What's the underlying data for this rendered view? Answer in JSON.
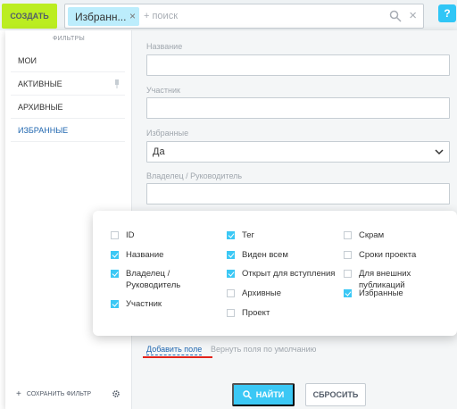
{
  "toolbar": {
    "create_label": "СОЗДАТЬ",
    "search": {
      "chip_label": "Избранн...",
      "placeholder": "+ поиск"
    },
    "help_label": "?"
  },
  "filter_panel": {
    "presets_title": "ФИЛЬТРЫ",
    "presets": [
      {
        "label": "МОИ"
      },
      {
        "label": "АКТИВНЫЕ"
      },
      {
        "label": "АРХИВНЫЕ"
      },
      {
        "label": "ИЗБРАННЫЕ"
      }
    ],
    "save_filter_label": "СОХРАНИТЬ ФИЛЬТР",
    "fields": {
      "name_label": "Название",
      "member_label": "Участник",
      "favorites_label": "Избранные",
      "favorites_value": "Да",
      "owner_label": "Владелец / Руководитель"
    },
    "add_field_label": "Добавить поле",
    "restore_fields_label": "Вернуть поля по умолчанию",
    "find_label": "НАЙТИ",
    "reset_label": "СБРОСИТЬ"
  },
  "field_picker": {
    "columns": [
      [
        {
          "label": "ID",
          "checked": false
        },
        {
          "label": "Название",
          "checked": true
        },
        {
          "label": "Владелец / Руководитель",
          "checked": true
        },
        {
          "label": "Участник",
          "checked": true
        }
      ],
      [
        {
          "label": "Тег",
          "checked": true
        },
        {
          "label": "Виден всем",
          "checked": true
        },
        {
          "label": "Открыт для вступления",
          "checked": true
        },
        {
          "label": "Архивные",
          "checked": false
        },
        {
          "label": "Проект",
          "checked": false
        }
      ],
      [
        {
          "label": "Скрам",
          "checked": false
        },
        {
          "label": "Сроки проекта",
          "checked": false
        },
        {
          "label": "Для внешних публикаций",
          "checked": false
        },
        {
          "label": "Избранные",
          "checked": true
        }
      ]
    ]
  },
  "colors": {
    "create_button": "#bbed21",
    "accent": "#3bc8f5",
    "link": "#2067b0",
    "highlight_underline": "#e2231a"
  }
}
